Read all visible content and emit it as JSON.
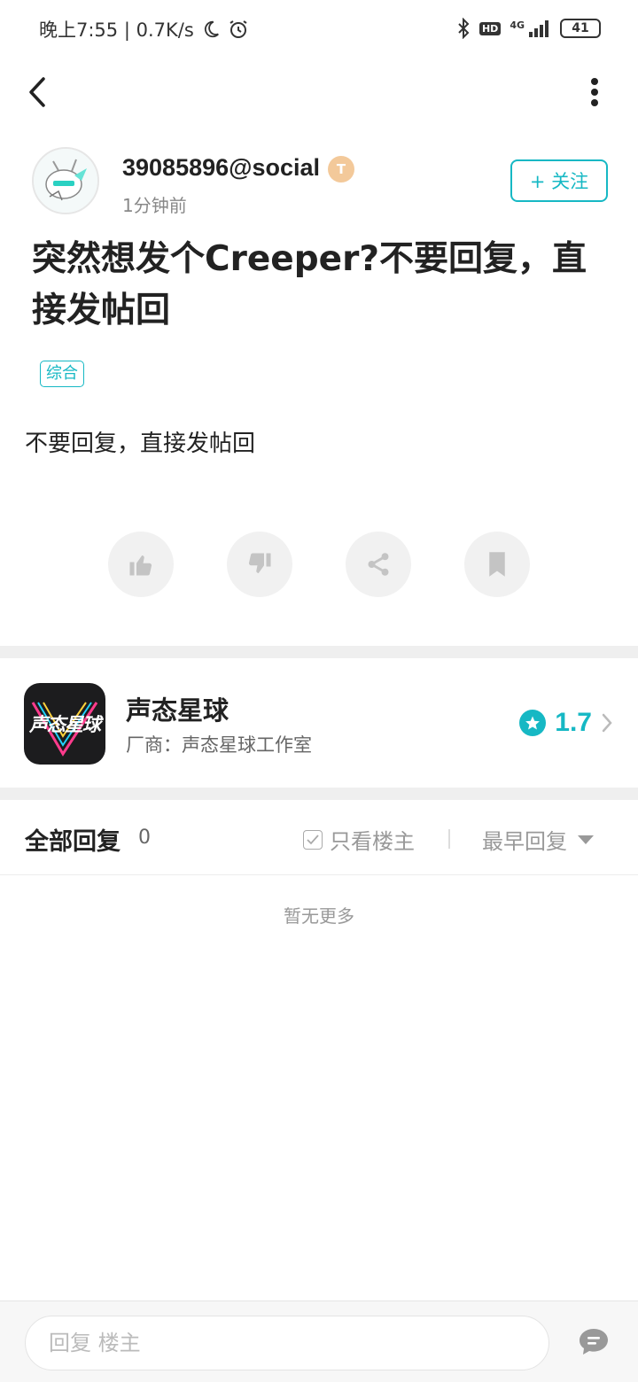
{
  "status_bar": {
    "time_speed": "晚上7:55 | 0.7K/s",
    "network": "4G",
    "hd_label": "HD",
    "battery": "41"
  },
  "post": {
    "author": "39085896@social",
    "level_badge": "T",
    "time": "1分钟前",
    "follow_label": "+ 关注",
    "title": "突然想发个Creeper?不要回复，直接发帖回",
    "tag": "综合",
    "body": "不要回复，直接发帖回"
  },
  "game": {
    "icon_text": "声态星球",
    "name": "声态星球",
    "vendor": "厂商：声态星球工作室",
    "rating": "1.7"
  },
  "replies": {
    "title": "全部回复",
    "count": "0",
    "only_op_label": "只看楼主",
    "sort_label": "最早回复",
    "empty": "暂无更多"
  },
  "bottom": {
    "input_placeholder": "回复  楼主"
  },
  "colors": {
    "accent": "#16b8c4",
    "badge": "#f3c99a",
    "divider": "#efefef"
  },
  "icons": [
    "back-icon",
    "more-icon",
    "bluetooth-icon",
    "signal-icon",
    "moon-icon",
    "alarm-icon",
    "like-icon",
    "dislike-icon",
    "share-icon",
    "bookmark-icon",
    "star-icon",
    "chevron-right-icon",
    "checkbox-icon",
    "caret-down-icon",
    "comment-icon"
  ]
}
